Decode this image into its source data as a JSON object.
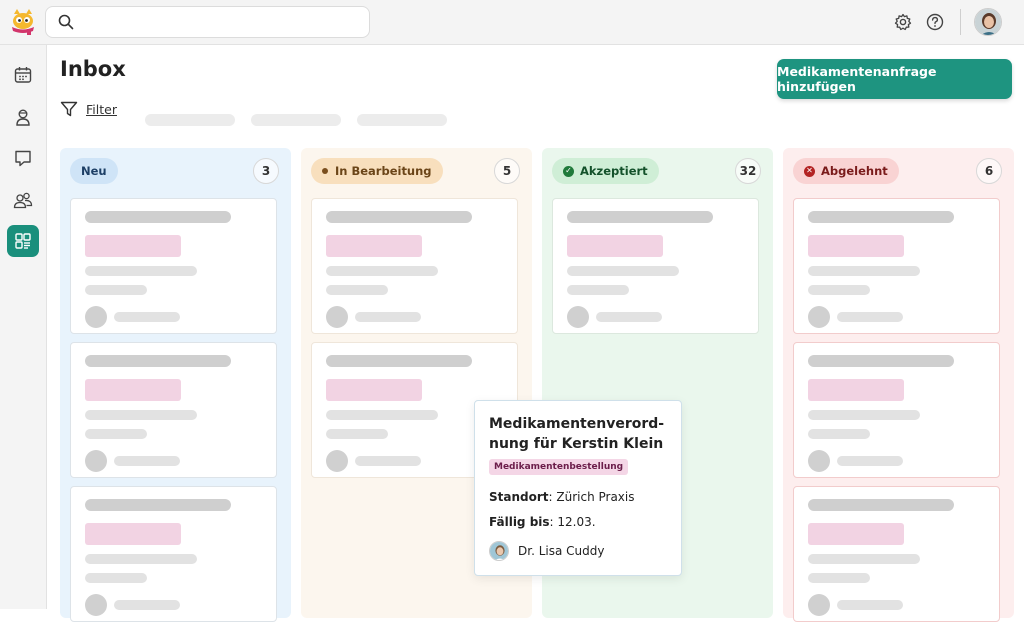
{
  "header": {
    "search_placeholder": "",
    "search_value": ""
  },
  "page": {
    "title": "Inbox",
    "add_button_label": "Medikamentenanfrage hinzufügen",
    "filter_label": "Filter"
  },
  "columns": [
    {
      "label": "Neu",
      "count": "3",
      "color": "#e6f2fc",
      "badge_color": "#cfe4f7",
      "text_color": "#1d3f66",
      "icon": "none"
    },
    {
      "label": "In Bearbeitung",
      "count": "5",
      "color": "#fcf6ee",
      "badge_color": "#f8dfbd",
      "text_color": "#6b4518",
      "icon": "dot"
    },
    {
      "label": "Akzeptiert",
      "count": "32",
      "color": "#eaf7ed",
      "badge_color": "#cfeed6",
      "text_color": "#13512a",
      "icon": "check-circle"
    },
    {
      "label": "Abgelehnt",
      "count": "6",
      "color": "#fdeeee",
      "badge_color": "#f9d3d3",
      "text_color": "#7a1b1b",
      "icon": "x-circle"
    }
  ],
  "popup": {
    "title": "Medikamentenverord-nung für Kerstin Klein",
    "tag": "Medikamentenbestellung",
    "location_label": "Standort",
    "location_value": "Zürich Praxis",
    "due_label": "Fällig bis",
    "due_value": "12.03.",
    "assignee": "Dr. Lisa Cuddy"
  },
  "colors": {
    "accent": "#1e9480",
    "sidebar_active": "#1a8f7c"
  }
}
